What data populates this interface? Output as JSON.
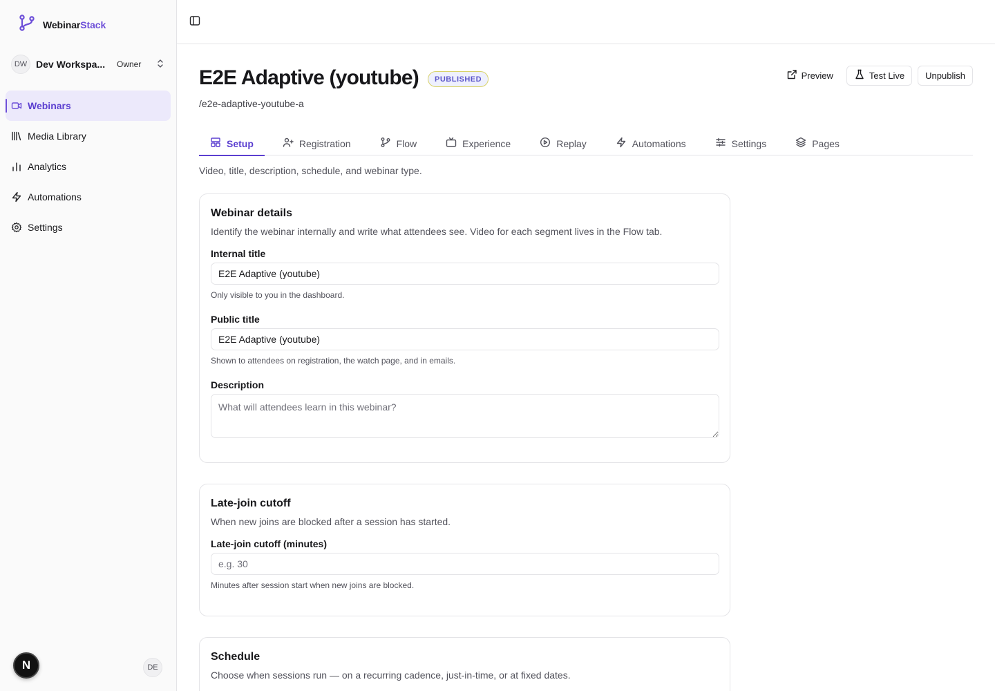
{
  "brand": {
    "name_primary": "Webinar",
    "name_accent": "Stack"
  },
  "workspace": {
    "initials": "DW",
    "name": "Dev Workspa...",
    "role": "Owner"
  },
  "sidebar": {
    "items": [
      {
        "label": "Webinars",
        "icon": "video-icon",
        "active": true
      },
      {
        "label": "Media Library",
        "icon": "library-icon"
      },
      {
        "label": "Analytics",
        "icon": "bar-chart-icon"
      },
      {
        "label": "Automations",
        "icon": "zap-icon"
      },
      {
        "label": "Settings",
        "icon": "gear-icon"
      }
    ]
  },
  "user": {
    "initials": "DE",
    "badge_letter": "N"
  },
  "header": {
    "title": "E2E Adaptive (youtube)",
    "status": "PUBLISHED",
    "slug": "/e2e-adaptive-youtube-a",
    "actions": {
      "preview": "Preview",
      "test_live": "Test Live",
      "unpublish": "Unpublish"
    }
  },
  "tabs": [
    {
      "label": "Setup",
      "icon": "layout-icon",
      "active": true
    },
    {
      "label": "Registration",
      "icon": "user-plus-icon"
    },
    {
      "label": "Flow",
      "icon": "git-branch-icon"
    },
    {
      "label": "Experience",
      "icon": "tv-icon"
    },
    {
      "label": "Replay",
      "icon": "play-circle-icon"
    },
    {
      "label": "Automations",
      "icon": "zap-icon"
    },
    {
      "label": "Settings",
      "icon": "sliders-icon"
    },
    {
      "label": "Pages",
      "icon": "layers-icon"
    }
  ],
  "tab_description": "Video, title, description, schedule, and webinar type.",
  "webinar_details": {
    "title": "Webinar details",
    "description": "Identify the webinar internally and write what attendees see. Video for each segment lives in the Flow tab.",
    "internal_title": {
      "label": "Internal title",
      "value": "E2E Adaptive (youtube)",
      "hint": "Only visible to you in the dashboard."
    },
    "public_title": {
      "label": "Public title",
      "value": "E2E Adaptive (youtube)",
      "hint": "Shown to attendees on registration, the watch page, and in emails."
    },
    "description_field": {
      "label": "Description",
      "placeholder": "What will attendees learn in this webinar?"
    }
  },
  "late_join": {
    "title": "Late-join cutoff",
    "description": "When new joins are blocked after a session has started.",
    "field": {
      "label": "Late-join cutoff (minutes)",
      "placeholder": "e.g. 30",
      "hint": "Minutes after session start when new joins are blocked."
    }
  },
  "schedule": {
    "title": "Schedule",
    "description": "Choose when sessions run — on a recurring cadence, just-in-time, or at fixed dates."
  },
  "colors": {
    "accent": "#6d4fd8",
    "badge_bg": "#eef0fd"
  }
}
